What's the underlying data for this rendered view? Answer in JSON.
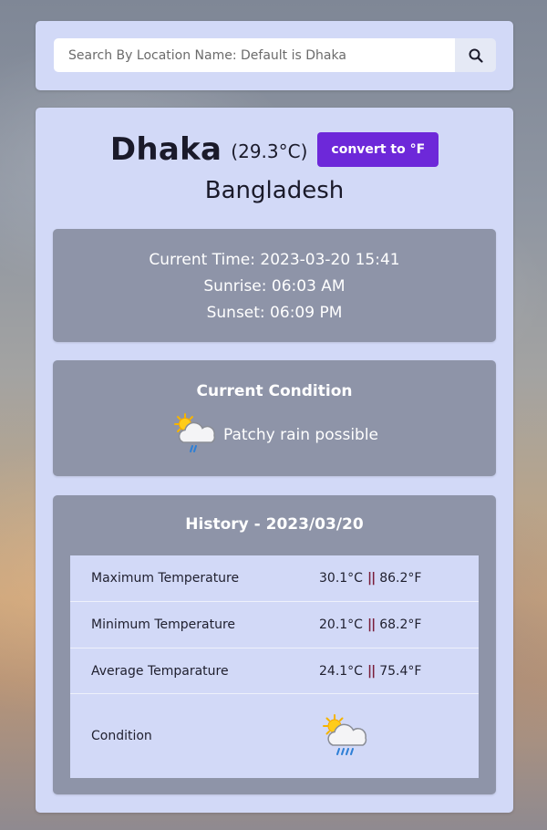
{
  "search": {
    "placeholder": "Search By Location Name: Default is Dhaka",
    "button_icon": "search-icon"
  },
  "location": {
    "city": "Dhaka",
    "temperature": "(29.3°C)",
    "convert_label": "convert to °F",
    "country": "Bangladesh"
  },
  "time_info": {
    "current_time": "Current Time: 2023-03-20 15:41",
    "sunrise": "Sunrise: 06:03 AM",
    "sunset": "Sunset: 06:09 PM"
  },
  "current_condition": {
    "title": "Current Condition",
    "icon": "patchy-rain-icon",
    "text": "Patchy rain possible"
  },
  "history": {
    "title": "History - 2023/03/20",
    "rows": [
      {
        "label": "Maximum Temperature",
        "c": "30.1°C",
        "f": "86.2°F"
      },
      {
        "label": "Minimum Temperature",
        "c": "20.1°C",
        "f": "68.2°F"
      },
      {
        "label": "Average Temparature",
        "c": "24.1°C",
        "f": "75.4°F"
      }
    ],
    "condition_label": "Condition",
    "condition_icon": "patchy-rain-icon",
    "separator": "||"
  },
  "colors": {
    "card_bg": "#d2d9f7",
    "panel_bg": "#8e94a8",
    "accent": "#6d28d9"
  }
}
